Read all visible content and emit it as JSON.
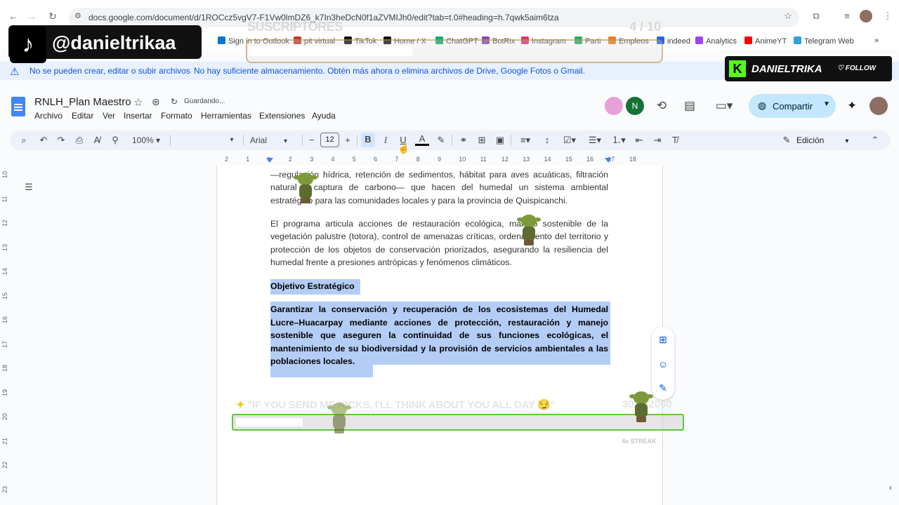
{
  "browser": {
    "url": "docs.google.com/document/d/1ROCcz5vgV7-F1Vw0lmDZ6_k7In3heDcN0f1aZVMIJh0/edit?tab=t.0#heading=h.7qwk5aim6tza",
    "bookmarks": [
      {
        "label": "Sign in to Outlook",
        "color": "#0078d4"
      },
      {
        "label": "pit virtual",
        "color": "#c0392b"
      },
      {
        "label": "TikTok",
        "color": "#111111"
      },
      {
        "label": "Home / X",
        "color": "#111111"
      },
      {
        "label": "ChatGPT",
        "color": "#10a37f"
      },
      {
        "label": "BotRix",
        "color": "#8e44ad"
      },
      {
        "label": "Instagram",
        "color": "#e1306c"
      },
      {
        "label": "Parti",
        "color": "#27ae60"
      },
      {
        "label": "Empleos",
        "color": "#e67e22"
      },
      {
        "label": "indeed",
        "color": "#2164f3"
      },
      {
        "label": "Analytics",
        "color": "#a142f4"
      },
      {
        "label": "AnimeYT",
        "color": "#ff0000"
      },
      {
        "label": "Telegram Web",
        "color": "#2aa3df"
      }
    ]
  },
  "overlay": {
    "tiktok_handle": "@danieltrikaa",
    "subs_label": "SUSCRIPTORES",
    "subs_count": "4 / 10",
    "subs_progress": 0.4,
    "kick_name": "DANIELTRIKA",
    "kick_follow": "FOLLOW",
    "kick_goal_text": "\"IF YOU SEND ME KICKS, I'LL THINK ABOUT YOU ALL DAY 😏\"",
    "kick_goal_count": "302 / 2000",
    "kick_goal_progress": 0.151,
    "streak": "4x STREAK"
  },
  "warning": {
    "title": "No se pueden crear, editar o subir archivos",
    "message": "No hay suficiente almacenamiento. Obtén más ahora o elimina archivos de Drive, Google Fotos o Gmail."
  },
  "doc": {
    "title": "RNLH_Plan Maestro",
    "save_status": "Guardando...",
    "menus": [
      "Archivo",
      "Editar",
      "Ver",
      "Insertar",
      "Formato",
      "Herramientas",
      "Extensiones",
      "Ayuda"
    ],
    "share_label": "Compartir",
    "avatar_letter": "N",
    "zoom": "100%",
    "font": "Arial",
    "font_size": "12",
    "edit_mode": "Edición",
    "ruler_numbers": [
      "2",
      "1",
      "1",
      "2",
      "3",
      "4",
      "5",
      "6",
      "7",
      "8",
      "9",
      "10",
      "11",
      "12",
      "13",
      "14",
      "15",
      "16",
      "17",
      "18"
    ],
    "vruler_numbers": [
      "10",
      "11",
      "12",
      "13",
      "14",
      "15",
      "16",
      "17",
      "18",
      "19",
      "20",
      "21",
      "22",
      "23"
    ],
    "paragraph1": "—regulación hídrica, retención de sedimentos, hábitat para aves acuáticas, filtración natural y captura de carbono— que hacen del humedal un sistema ambiental estratégico para las comunidades locales y para la provincia de Quispicanchi.",
    "paragraph2": "El programa articula acciones de restauración ecológica, manejo sostenible de la vegetación palustre (totora), control de amenazas críticas, ordenamiento del territorio y protección de los objetos de conservación priorizados, asegurando la resiliencia del humedal frente a presiones antrópicas y fenómenos climáticos.",
    "objective_title": "Objetivo Estratégico",
    "objective_body": "Garantizar la conservación y recuperación de los ecosistemas del Humedal Lucre–Huacarpay mediante acciones de protección, restauración y manejo sostenible que aseguren la continuidad de sus funciones ecológicas, el mantenimiento de su biodiversidad y la provisión de servicios ambientales a las poblaciones locales."
  },
  "colors": {
    "accent": "#0b57d0",
    "share_bg": "#c2e7ff",
    "selection": "#b4cdf6",
    "kick_green": "#53fc18"
  }
}
